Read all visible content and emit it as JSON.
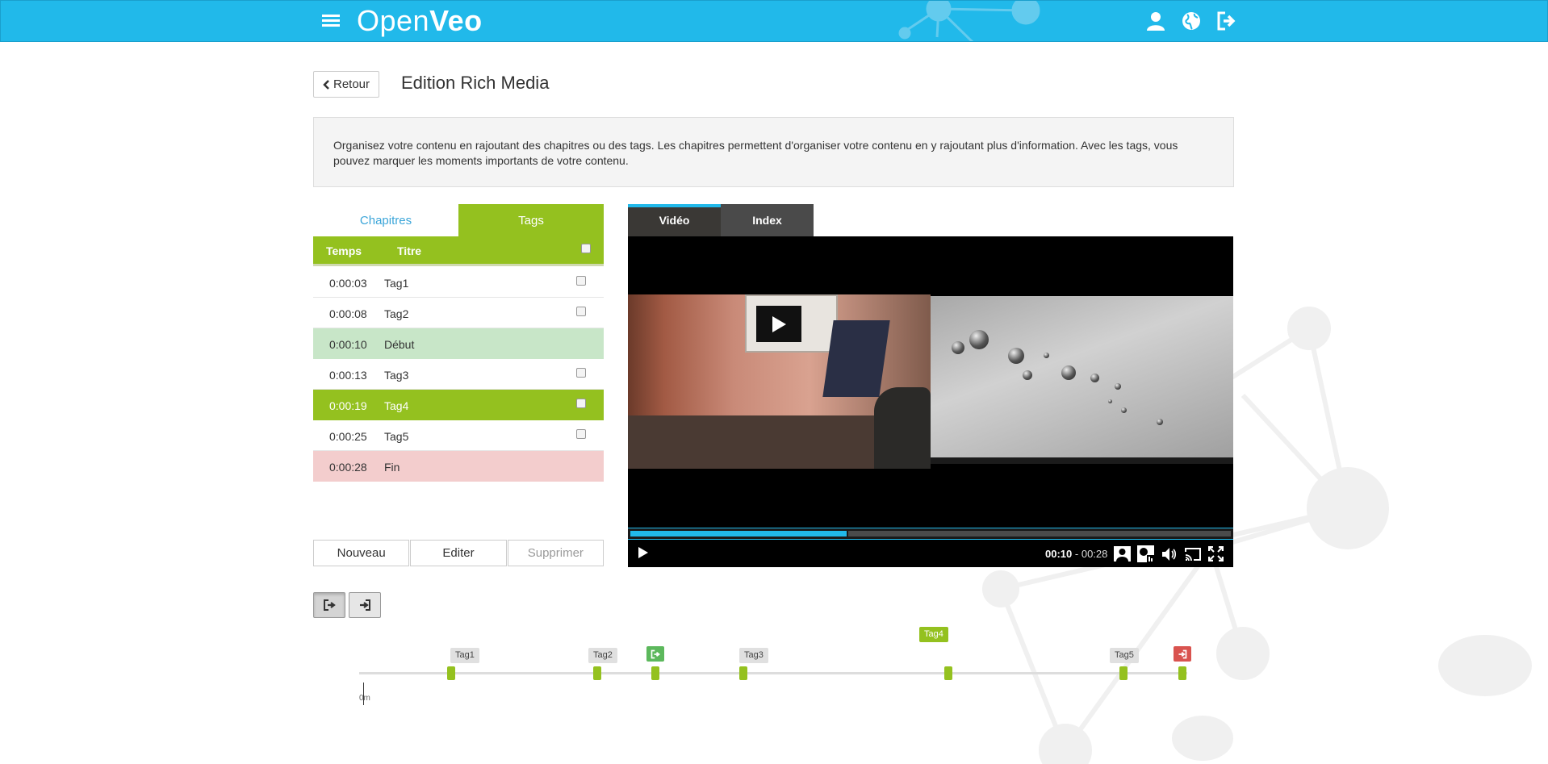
{
  "header": {
    "logo_light": "Open",
    "logo_bold": "Veo",
    "icons": [
      "menu-icon",
      "user-icon",
      "globe-icon",
      "logout-icon"
    ],
    "brand_color": "#21b9ea"
  },
  "page": {
    "back_label": "Retour",
    "title": "Edition Rich Media",
    "info": "Organisez votre contenu en rajoutant des chapitres ou des tags. Les chapitres permettent d'organiser votre contenu en y rajoutant plus d'information. Avec les tags, vous pouvez marquer les moments importants de votre contenu."
  },
  "tabs": [
    {
      "label": "Chapitres",
      "active": false
    },
    {
      "label": "Tags",
      "active": true
    }
  ],
  "table": {
    "col_time": "Temps",
    "col_title": "Titre",
    "rows": [
      {
        "time": "0:00:03",
        "title": "Tag1",
        "type": "tag"
      },
      {
        "time": "0:00:08",
        "title": "Tag2",
        "type": "tag"
      },
      {
        "time": "0:00:10",
        "title": "Début",
        "type": "begin"
      },
      {
        "time": "0:00:13",
        "title": "Tag3",
        "type": "tag"
      },
      {
        "time": "0:00:19",
        "title": "Tag4",
        "type": "selected"
      },
      {
        "time": "0:00:25",
        "title": "Tag5",
        "type": "tag"
      },
      {
        "time": "0:00:28",
        "title": "Fin",
        "type": "end"
      }
    ]
  },
  "actions": {
    "new": "Nouveau",
    "edit": "Editer",
    "delete": "Supprimer"
  },
  "player": {
    "tab_video": "Vidéo",
    "tab_index": "Index",
    "current_time": "00:10",
    "separator": "-",
    "duration": "00:28",
    "progress": 0.36
  },
  "timeline": {
    "zero_label": "0m",
    "labels": {
      "tag1": "Tag1",
      "tag2": "Tag2",
      "tag3": "Tag3",
      "tag4": "Tag4",
      "tag5": "Tag5"
    },
    "accent": "#94c11f",
    "start_color": "#5cb85c",
    "end_color": "#d9534f"
  }
}
